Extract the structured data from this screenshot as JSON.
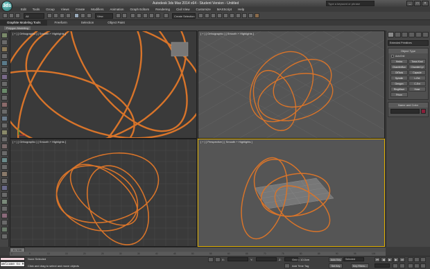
{
  "window": {
    "app_logo": "3ds",
    "title": "Autodesk 3ds Max 2014 x64 - Student Version - Untitled",
    "search_placeholder": "Type a keyword or phrase"
  },
  "menu": [
    "Edit",
    "Tools",
    "Group",
    "Views",
    "Create",
    "Modifiers",
    "Animation",
    "Graph Editors",
    "Rendering",
    "Civil View",
    "Customize",
    "MAXScript",
    "Help"
  ],
  "toolbar": {
    "undo_dropdown": "All",
    "view_dropdown": "View",
    "selection_set": "Create Selection Se"
  },
  "ribbon": {
    "tabs": [
      "Graphite Modeling Tools",
      "Freeform",
      "Selection",
      "Object Paint"
    ],
    "active_tab_index": 0,
    "sub_label": "Polygon Modeling"
  },
  "viewports": {
    "top_left": "[ + ] [ Orthographic ] [ Smooth + Highlights ]",
    "top_right": "[ + ] [ Orthographic ] [ Smooth + Highlights ]",
    "bottom_left": "[ + ] [ Orthographic ] [ Smooth + Highlights ]",
    "bottom_right": "[ + ] [ Perspective ] [ Smooth + Highlights ]"
  },
  "command_panel": {
    "category_dropdown": "Extended Primitives",
    "object_type_title": "Object Type",
    "autogrid_label": "AutoGrid",
    "object_buttons": [
      "Hedra",
      "Torus Knot",
      "ChamferBox",
      "ChamferCyl",
      "OilTank",
      "Capsule",
      "Spindle",
      "L-Ext",
      "Gengon",
      "C-Ext",
      "RingWave",
      "Hose",
      "Prism"
    ],
    "name_color_title": "Name and Color"
  },
  "timeline": {
    "slider_label": "0 / 100",
    "ruler_ticks": [
      "0",
      "5",
      "10",
      "15",
      "20",
      "25",
      "30",
      "35",
      "40",
      "45",
      "50",
      "55",
      "60",
      "65",
      "70",
      "75",
      "80",
      "85",
      "90",
      "95",
      "100"
    ]
  },
  "statusbar": {
    "maxscript_text": "Welcome to M",
    "status_line1": "None Selected",
    "status_line2": "Click and drag to select and move objects",
    "x_label": "X:",
    "y_label": "Y:",
    "z_label": "Z:",
    "grid_text": "Grid = 10.0cm",
    "add_time_tag": "Add Time Tag",
    "auto_key": "Auto Key",
    "selected_dropdown": "Selected",
    "set_key": "Set Key",
    "key_filters": "Key Filters..."
  },
  "colors": {
    "rings": "#d8742a",
    "object_color_swatch": "#8a1f3a"
  }
}
